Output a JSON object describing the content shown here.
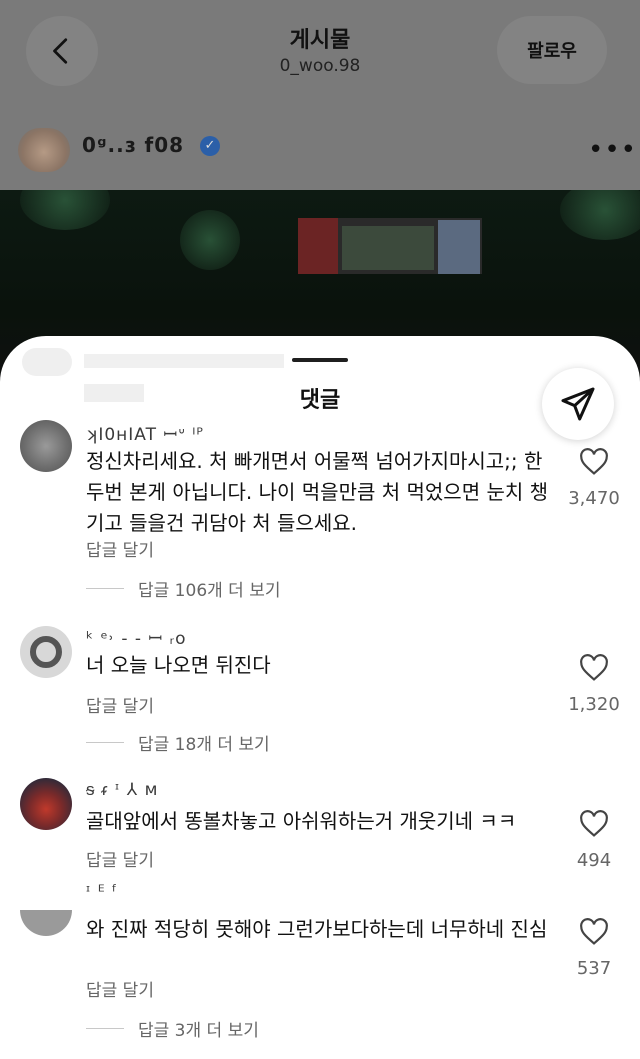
{
  "header": {
    "title": "게시물",
    "subtitle": "0_woo.98",
    "follow_label": "팔로우",
    "author_name": "0ᵍ..ɜ f08"
  },
  "sheet": {
    "title": "댓글"
  },
  "icons": {
    "back": "chevron-left-icon",
    "more": "more-horizontal-icon",
    "share": "send-icon",
    "like": "heart-outline-icon",
    "verified": "verified-badge-icon"
  },
  "colors": {
    "accent_verified": "#2b5fa8",
    "text_secondary": "#666666"
  },
  "comments": [
    {
      "user": "ʞI0ʜIAT ꟷᐡ ᴵᴾ",
      "text": "정신차리세요. 처 빠개면서 어물쩍 넘어가지마시고;; 한두번 본게 아닙니다. 나이 먹을만큼 처 먹었으면 눈치 챙기고 들을건 귀담아 처 들으세요.",
      "reply": "답글 달기",
      "view_replies": "답글 106개 더 보기",
      "likes": "3,470"
    },
    {
      "user": "ᵏ ᵉ˒ ‐ ‐ ꟷ ᵣᴏ",
      "text": "너 오늘 나오면 뒤진다",
      "reply": "답글 달기",
      "view_replies": "답글 18개 더 보기",
      "likes": "1,320"
    },
    {
      "user": "ᵴ ᵳ ᶦ ⅄ ᴍ",
      "text": "골대앞에서 똥볼차놓고 아쉬워하는거 개웃기네 ㅋㅋ",
      "reply": "답글 달기",
      "view_replies": "",
      "likes": "494"
    },
    {
      "user": "ᶦ ᴱ ᶠ",
      "text": "와 진짜 적당히 못해야 그런가보다하는데 너무하네 진심",
      "reply": "답글 달기",
      "view_replies": "답글 3개 더 보기",
      "likes": "537"
    }
  ]
}
